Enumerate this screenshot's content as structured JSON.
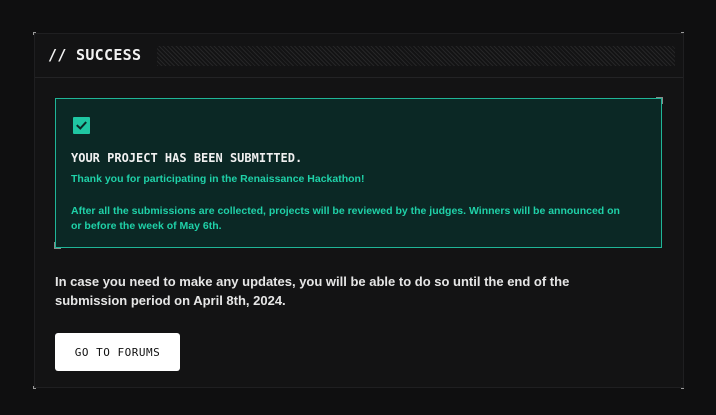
{
  "header": {
    "title": "// SUCCESS"
  },
  "success": {
    "check_icon": "check-icon",
    "heading": "YOUR PROJECT HAS BEEN SUBMITTED.",
    "thanks": "Thank you for participating in the Renaissance Hackathon!",
    "review": "After all the submissions are collected, projects will be reviewed by the judges. Winners will be announced on or before the week of May 6th."
  },
  "body": {
    "update_note": "In case you need to make any updates, you will be able to do so until the end of the submission period on April 8th, 2024."
  },
  "actions": {
    "forums_label": "GO TO FORUMS"
  },
  "colors": {
    "accent": "#1fc6a2",
    "box_background": "#0b2825",
    "page_background": "#0f0f10"
  }
}
